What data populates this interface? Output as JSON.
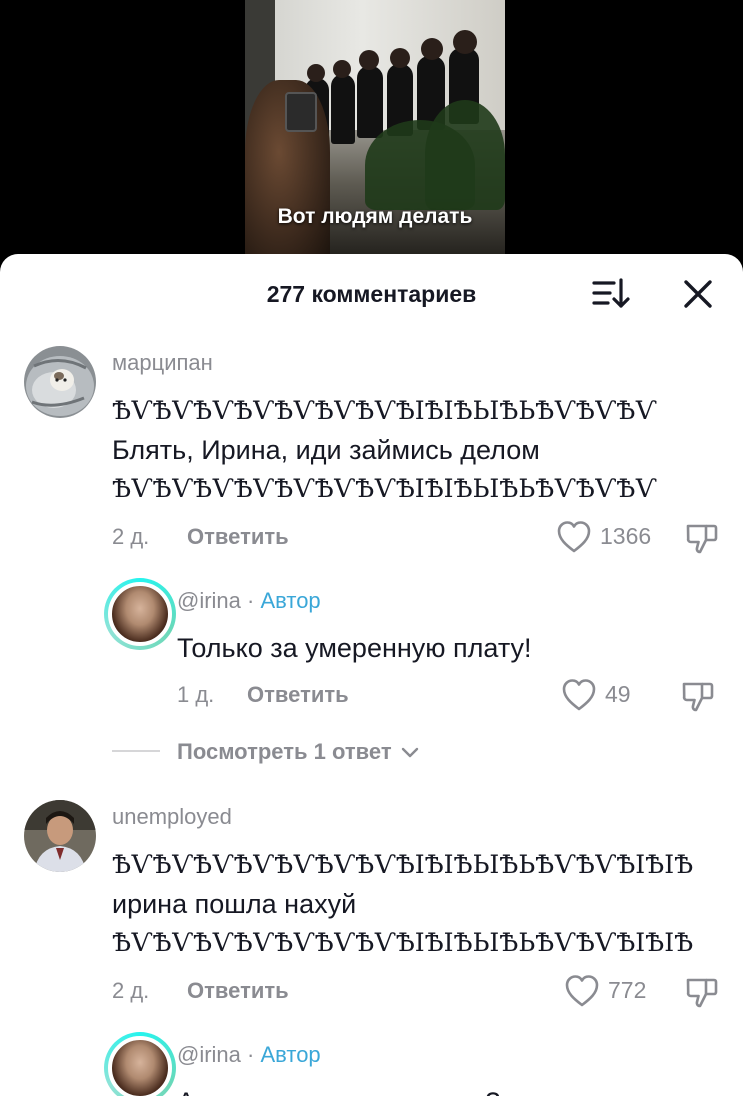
{
  "video": {
    "caption": "Вот людям делать"
  },
  "header": {
    "title": "277 комментариев",
    "sort_icon": "sort-icon",
    "close_icon": "close-icon"
  },
  "comments": [
    {
      "username": "марципан",
      "lines": [
        "ѢѴѢѴѢѴѢѴѢѴѢѴѢѴѢІѢІѢЬІѢЬѢѴѢѴѢѴ",
        "Блять, Ирина, иди займись делом",
        "ѢѴѢѴѢѴѢѴѢѴѢѴѢѴѢІѢІѢЬІѢЬѢѴѢѴѢѴ"
      ],
      "time": "2 д.",
      "reply_label": "Ответить",
      "likes": "1366",
      "reply": {
        "username": "@irina",
        "separator": "·",
        "badge": "Автор",
        "text": "Только за умеренную плату!",
        "time": "1 д.",
        "reply_label": "Ответить",
        "likes": "49"
      },
      "view_replies": "Посмотреть 1 ответ"
    },
    {
      "username": "unemployed",
      "lines": [
        "ѢѴѢѴѢѴѢѴѢѴѢѴѢѴѢІѢІѢЬІѢЬѢѴѢѴѢІѢІѢ",
        "ирина пошла нахуй",
        "ѢѴѢѴѢѴѢѴѢѴѢѴѢѴѢІѢІѢЬІѢЬѢѴѢѴѢІѢІѢ"
      ],
      "time": "2 д.",
      "reply_label": "Ответить",
      "likes": "772",
      "reply": {
        "username": "@irina",
        "separator": "·",
        "badge": "Автор",
        "text": "А вы, наверное, уже там?"
      }
    }
  ],
  "icons": {
    "like": "heart-icon",
    "dislike": "thumbs-down-icon"
  },
  "colors": {
    "author_badge": "#3aa7d8",
    "text": "#161823",
    "muted": "#8a8b91"
  }
}
